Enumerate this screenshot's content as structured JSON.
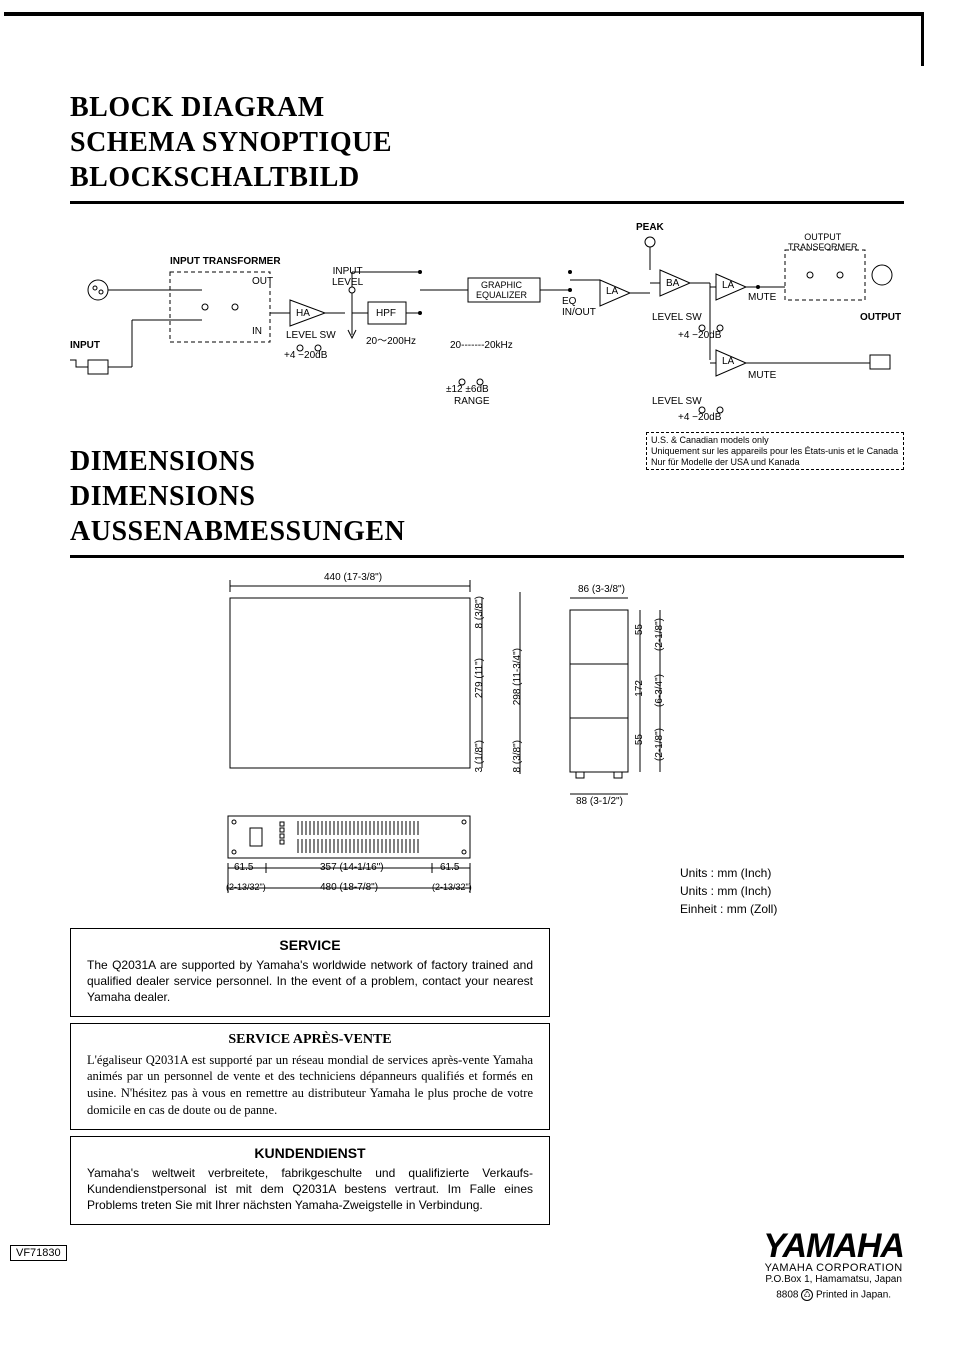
{
  "headings": {
    "block_diagram": {
      "l1": "BLOCK DIAGRAM",
      "l2": "SCHEMA SYNOPTIQUE",
      "l3": "BLOCKSCHALTBILD"
    },
    "dimensions": {
      "l1": "DIMENSIONS",
      "l2": "DIMENSIONS",
      "l3": "AUSSENABMESSUNGEN"
    }
  },
  "diagram_labels": {
    "input": "INPUT",
    "input_transformer": "INPUT TRANSFORMER",
    "out": "OUT",
    "in": "IN",
    "ha": "HA",
    "input_level": "INPUT\nLEVEL",
    "hpf": "HPF",
    "level_sw": "LEVEL SW",
    "level_sw_vals": "+4   −20dB",
    "hpf_range": "20～200Hz",
    "graphic_eq": "GRAPHIC\nEQUALIZER",
    "eq_inout": "EQ\nIN/OUT",
    "geq_range": "20-------20kHz",
    "geq_db": "±12   ±6dB",
    "range": "RANGE",
    "peak": "PEAK",
    "la": "LA",
    "ba": "BA",
    "mute": "MUTE",
    "output_transformer": "OUTPUT\nTRANSFORMER",
    "output": "OUTPUT"
  },
  "models_note": {
    "l1": "U.S. & Canadian models only",
    "l2": "Uniquement sur les appareils pour les États-unis et le Canada",
    "l3": "Nur für Modelle der USA und Kanada"
  },
  "dimensions_labels": {
    "w440": "440 (17-3/8\")",
    "h8": "8 (3/8\")",
    "h279": "279 (11\")",
    "h298": "298 (11-3/4\")",
    "h3": "3 (1/8\")",
    "h8b": "8 (3/8\")",
    "w86": "86 (3-3/8\")",
    "h55a": "55",
    "h55ai": "(2-1/8\")",
    "h172": "172",
    "h172i": "(6-3/4\")",
    "h55b": "55",
    "h55bi": "(2-1/8\")",
    "w88": "88 (3-1/2\")",
    "w61a": "61.5",
    "w61ai": "(2-13/32\")",
    "w357": "357 (14-1/16\")",
    "w61b": "61.5",
    "w61bi": "(2-13/32\")",
    "w480": "480 (18-7/8\")"
  },
  "units": {
    "l1": "Units : mm (Inch)",
    "l2": "Units : mm (Inch)",
    "l3": "Einheit : mm (Zoll)"
  },
  "service": {
    "en": {
      "title": "SERVICE",
      "body": "The Q2031A are supported by Yamaha's worldwide network of factory trained and qualified dealer service personnel. In the event of a problem, contact your nearest Yamaha dealer."
    },
    "fr": {
      "title": "SERVICE APRÈS-VENTE",
      "body": "L'égaliseur Q2031A est supporté par un réseau mondial de services après-vente Yamaha animés par un personnel de vente et des techniciens dépanneurs qualifiés et formés en usine. N'hésitez pas à vous en remettre au distributeur Yamaha le plus proche de votre domicile en cas de doute ou de panne."
    },
    "de": {
      "title": "KUNDENDIENST",
      "body": "Yamaha's weltweit verbreitete, fabrikgeschulte und qualifizierte Verkaufs-Kundendienstpersonal ist mit dem Q2031A bestens vertraut. Im Falle eines Problems treten Sie mit Ihrer nächsten Yamaha-Zweigstelle in Verbindung."
    }
  },
  "yamaha": {
    "logo": "YAMAHA",
    "corp": "YAMAHA CORPORATION",
    "addr": "P.O.Box 1, Hamamatsu, Japan",
    "print_code": "8808",
    "print_text": "Printed in Japan."
  },
  "doc_code": "VF71830"
}
